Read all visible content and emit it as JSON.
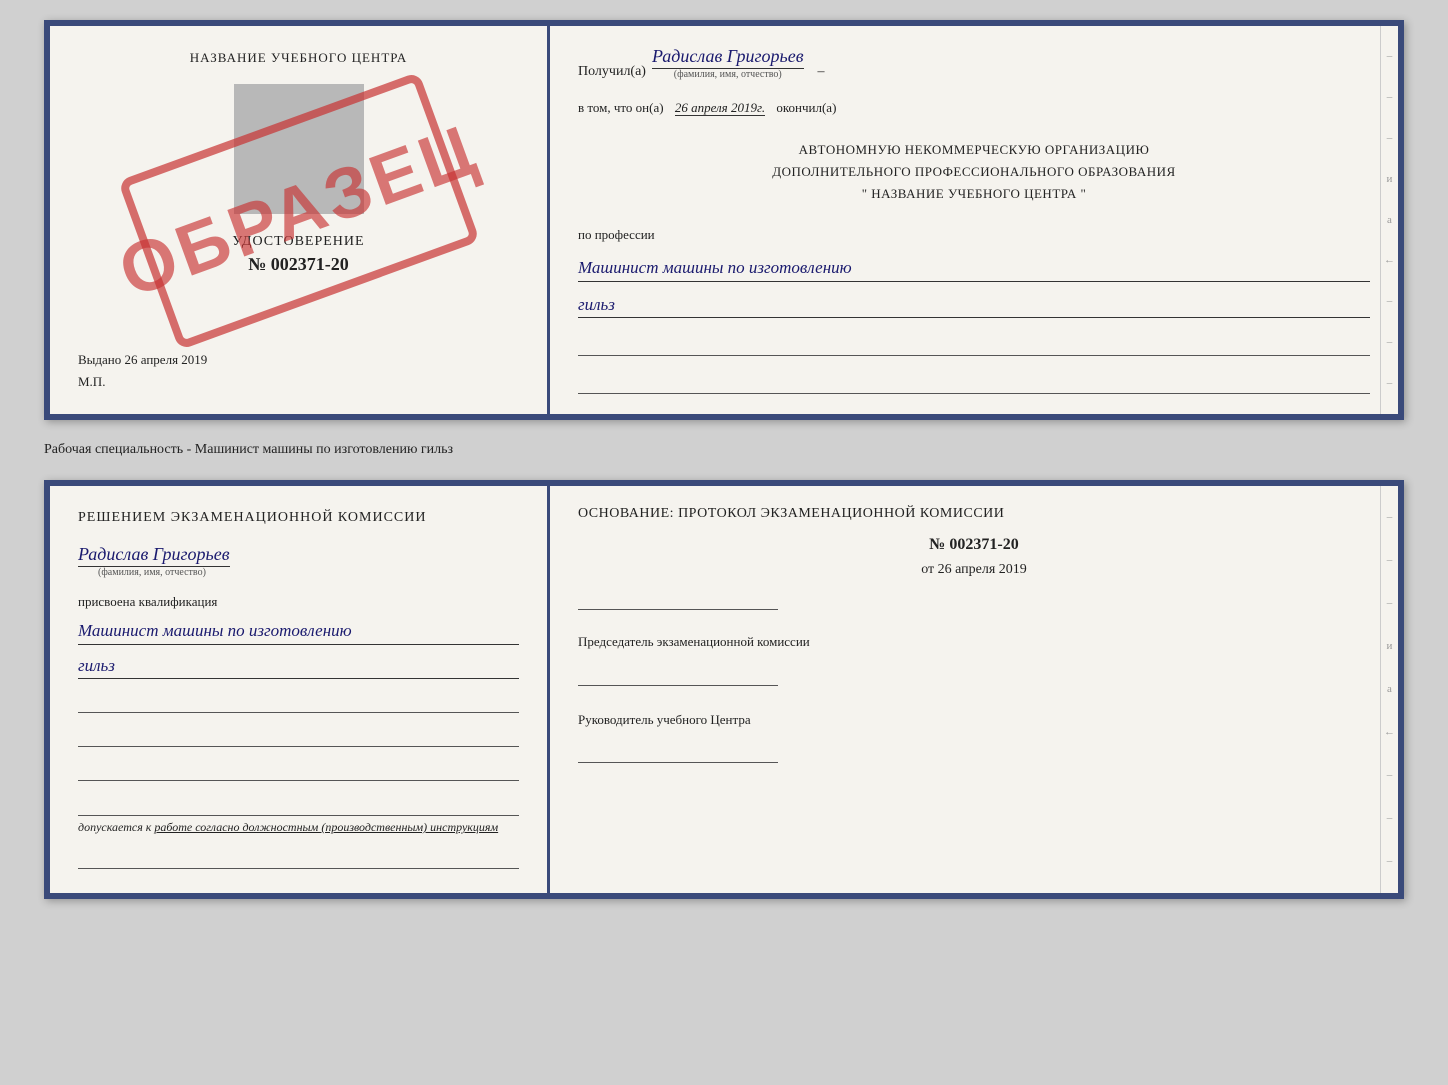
{
  "top_doc": {
    "left": {
      "center_title": "НАЗВАНИЕ УЧЕБНОГО ЦЕНТРА",
      "cert_title": "УДОСТОВЕРЕНИЕ",
      "cert_number": "№ 002371-20",
      "issued_label": "Выдано",
      "issued_date": "26 апреля 2019",
      "mp": "М.П.",
      "stamp_text": "ОБРАЗЕЦ"
    },
    "right": {
      "received_prefix": "Получил(а)",
      "recipient_name": "Радислав Григорьев",
      "name_label": "(фамилия, имя, отчество)",
      "in_that_prefix": "в том, что он(а)",
      "completion_date": "26 апреля 2019г.",
      "finished_label": "окончил(а)",
      "org_line1": "АВТОНОМНУЮ НЕКОММЕРЧЕСКУЮ ОРГАНИЗАЦИЮ",
      "org_line2": "ДОПОЛНИТЕЛЬНОГО ПРОФЕССИОНАЛЬНОГО ОБРАЗОВАНИЯ",
      "org_name": "НАЗВАНИЕ УЧЕБНОГО ЦЕНТРА",
      "profession_label": "по профессии",
      "profession_handwritten": "Машинист машины по изготовлению",
      "profession_handwritten2": "гильз"
    }
  },
  "separator_label": "Рабочая специальность - Машинист машины по изготовлению гильз",
  "bottom_doc": {
    "left": {
      "decision_title": "Решением  экзаменационной  комиссии",
      "person_name": "Радислав Григорьев",
      "name_label": "(фамилия, имя, отчество)",
      "assigned_label": "присвоена квалификация",
      "qualification_handwritten": "Машинист машины по изготовлению",
      "qualification_handwritten2": "гильз",
      "allow_text": "допускается к ",
      "allow_underline_text": "работе согласно должностным (производственным) инструкциям"
    },
    "right": {
      "basis_label": "Основание: протокол экзаменационной  комиссии",
      "protocol_number": "№  002371-20",
      "date_prefix": "от",
      "protocol_date": "26 апреля 2019",
      "chairman_label": "Председатель экзаменационной комиссии",
      "head_label": "Руководитель учебного Центра"
    }
  },
  "side_dashes": [
    "–",
    "–",
    "–",
    "и",
    "а",
    "←",
    "–",
    "–",
    "–"
  ],
  "side_dashes2": [
    "–",
    "–",
    "–",
    "и",
    "а",
    "←",
    "–",
    "–",
    "–"
  ]
}
